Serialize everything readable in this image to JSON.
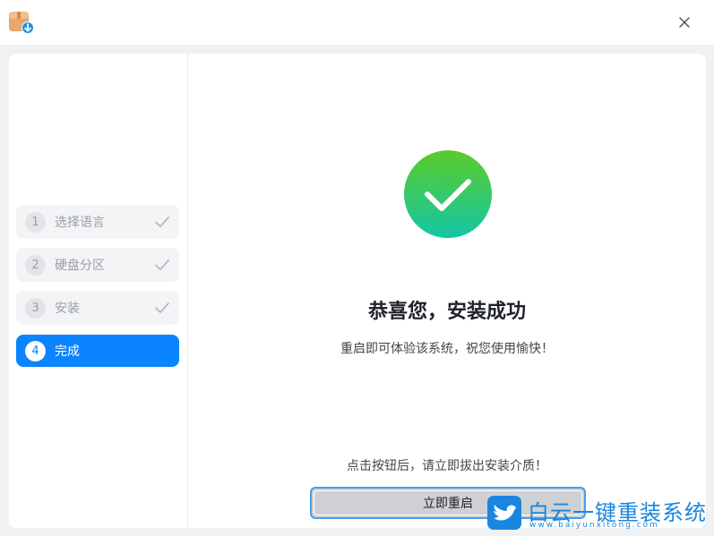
{
  "window": {
    "app_icon": "package-download-icon",
    "close_icon": "close-icon"
  },
  "steps": [
    {
      "num": "1",
      "label": "选择语言",
      "state": "done"
    },
    {
      "num": "2",
      "label": "硬盘分区",
      "state": "done"
    },
    {
      "num": "3",
      "label": "安装",
      "state": "done"
    },
    {
      "num": "4",
      "label": "完成",
      "state": "active"
    }
  ],
  "main": {
    "title": "恭喜您，安装成功",
    "subtitle": "重启即可体验该系统，祝您使用愉快！",
    "hint": "点击按钮后，请立即拔出安装介质！",
    "restart_label": "立即重启"
  },
  "watermark": {
    "text": "白云一键重装系统",
    "url": "www.baiyunxitong.com"
  },
  "colors": {
    "accent": "#0a84ff",
    "success_start": "#5ccb2a",
    "success_end": "#14c6a6"
  }
}
